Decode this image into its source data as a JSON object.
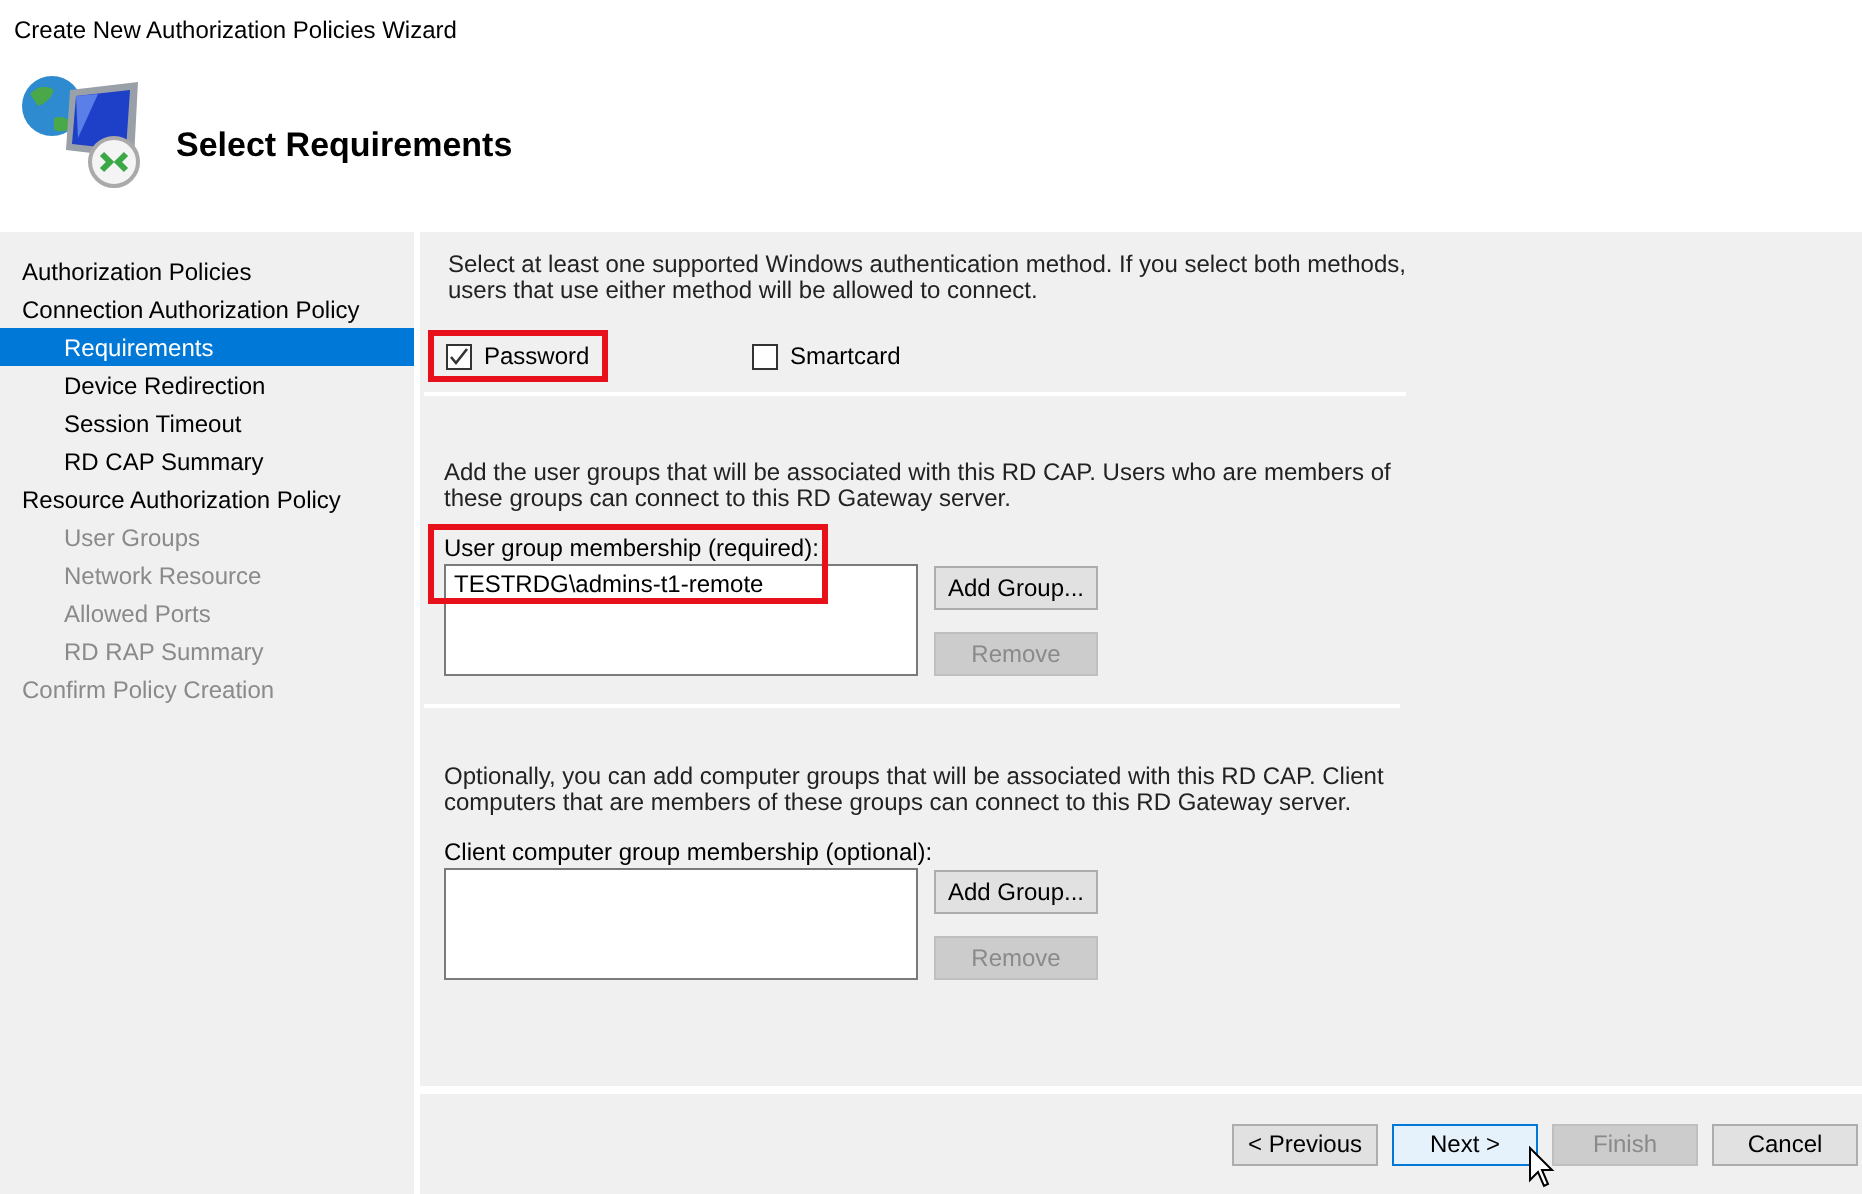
{
  "window": {
    "title": "Create New Authorization Policies Wizard"
  },
  "header": {
    "title": "Select Requirements"
  },
  "steps": [
    {
      "label": "Authorization Policies",
      "selected": false,
      "disabled": false
    },
    {
      "label": "Connection Authorization Policy",
      "selected": false,
      "disabled": false,
      "children": [
        {
          "label": "Requirements",
          "selected": true,
          "disabled": false
        },
        {
          "label": "Device Redirection",
          "selected": false,
          "disabled": false
        },
        {
          "label": "Session Timeout",
          "selected": false,
          "disabled": false
        },
        {
          "label": "RD CAP Summary",
          "selected": false,
          "disabled": false
        }
      ]
    },
    {
      "label": "Resource Authorization Policy",
      "selected": false,
      "disabled": false,
      "children": [
        {
          "label": "User Groups",
          "selected": false,
          "disabled": true
        },
        {
          "label": "Network Resource",
          "selected": false,
          "disabled": true
        },
        {
          "label": "Allowed Ports",
          "selected": false,
          "disabled": true
        },
        {
          "label": "RD RAP Summary",
          "selected": false,
          "disabled": true
        }
      ]
    },
    {
      "label": "Confirm Policy Creation",
      "selected": false,
      "disabled": true
    }
  ],
  "auth": {
    "text": "Select at least one supported Windows authentication method. If you select both methods, users that use either method will be allowed to connect.",
    "methods": [
      {
        "label": "Password",
        "checked": true,
        "highlighted": true
      },
      {
        "label": "Smartcard",
        "checked": false,
        "highlighted": false
      }
    ]
  },
  "user_groups": {
    "text": "Add the user groups that will be associated with this RD CAP. Users who are members of these groups can connect to this RD Gateway server.",
    "label": "User group membership (required):",
    "highlighted": true,
    "items": [
      "TESTRDG\\admins-t1-remote"
    ],
    "buttons": [
      {
        "label": "Add Group...",
        "disabled": false
      },
      {
        "label": "Remove",
        "disabled": true
      }
    ]
  },
  "computer_groups": {
    "text": "Optionally, you can add computer groups that will be associated with this RD CAP. Client computers that are members of these groups can connect to this RD Gateway server.",
    "label": "Client computer group membership (optional):",
    "highlighted": false,
    "buttons": [
      {
        "label": "Add Group...",
        "disabled": false
      },
      {
        "label": "Remove",
        "disabled": true
      }
    ]
  },
  "footer_buttons": [
    {
      "label": "< Previous",
      "disabled": false,
      "focused": false
    },
    {
      "label": "Next >",
      "disabled": false,
      "focused": true
    },
    {
      "label": "Finish",
      "disabled": true,
      "focused": false
    },
    {
      "label": "Cancel",
      "disabled": false,
      "focused": false
    }
  ]
}
